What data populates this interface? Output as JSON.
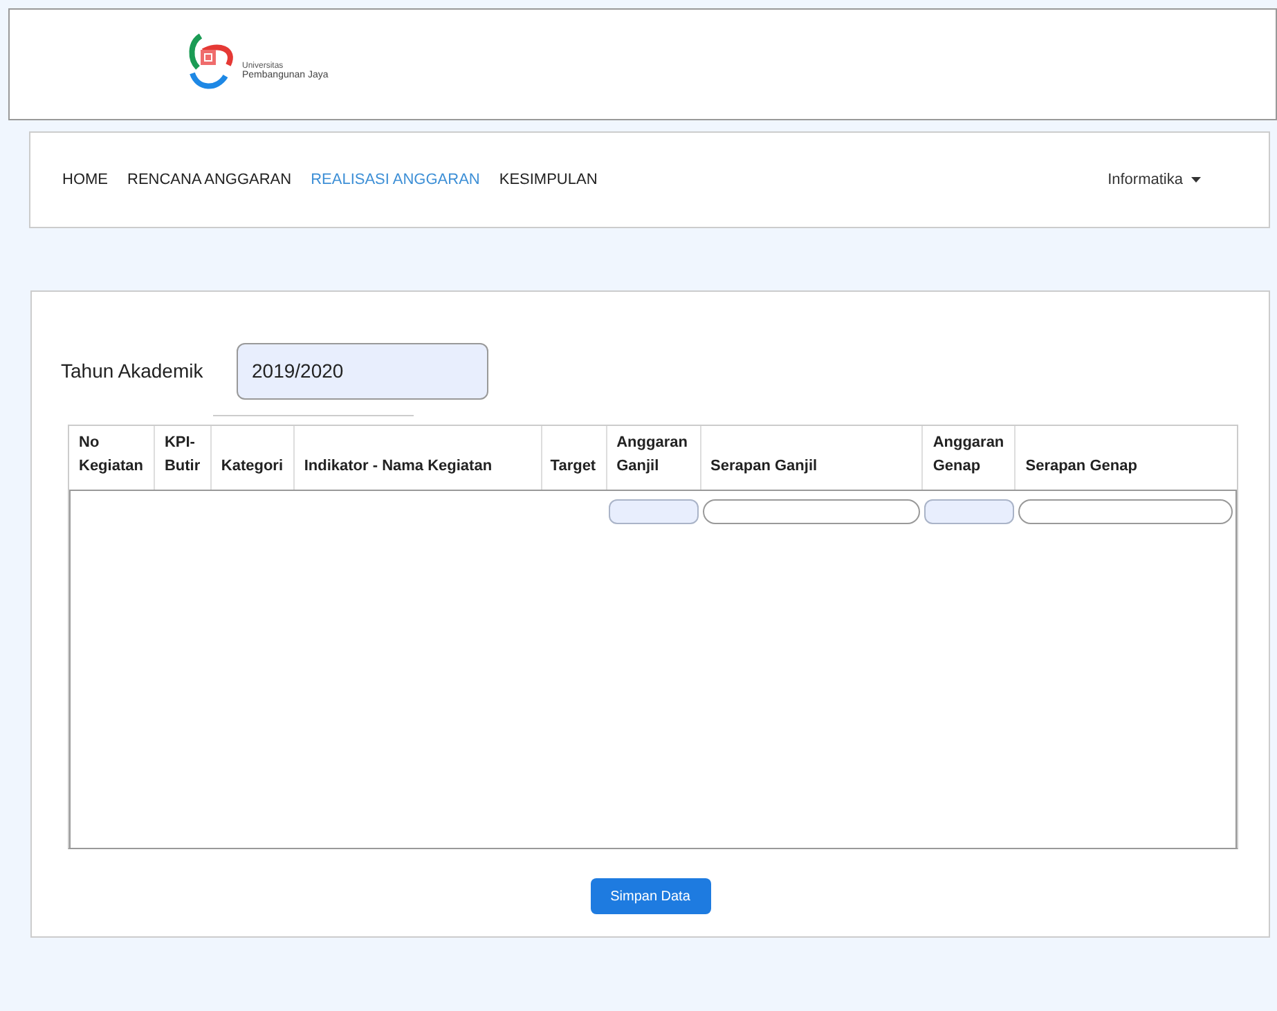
{
  "logo": {
    "line_1": "Universitas",
    "line_2": "Pembangunan Jaya"
  },
  "nav": {
    "items": [
      {
        "label": "HOME",
        "selected": false
      },
      {
        "label": "RENCANA ANGGARAN",
        "selected": false
      },
      {
        "label": "REALISASI ANGGARAN",
        "selected": true
      },
      {
        "label": "KESIMPULAN",
        "selected": false
      }
    ],
    "menu": {
      "label": "Informatika"
    }
  },
  "form": {
    "label": "Tahun Akademik",
    "value": "2019/2020"
  },
  "table": {
    "columns": [
      {
        "label": "No Kegiatan",
        "kind": "empty"
      },
      {
        "label": "KPI-Butir",
        "kind": "empty"
      },
      {
        "label": "Kategori",
        "kind": "empty"
      },
      {
        "label": "Indikator - Nama Kegiatan",
        "kind": "empty"
      },
      {
        "label": "Target",
        "kind": "empty"
      },
      {
        "label": "Anggaran Ganjil",
        "kind": "shaded"
      },
      {
        "label": "Serapan Ganjil",
        "kind": "rounded"
      },
      {
        "label": "Anggaran Genap",
        "kind": "shaded"
      },
      {
        "label": "Serapan Genap",
        "kind": "rounded"
      }
    ]
  },
  "button": "Simpan Data"
}
